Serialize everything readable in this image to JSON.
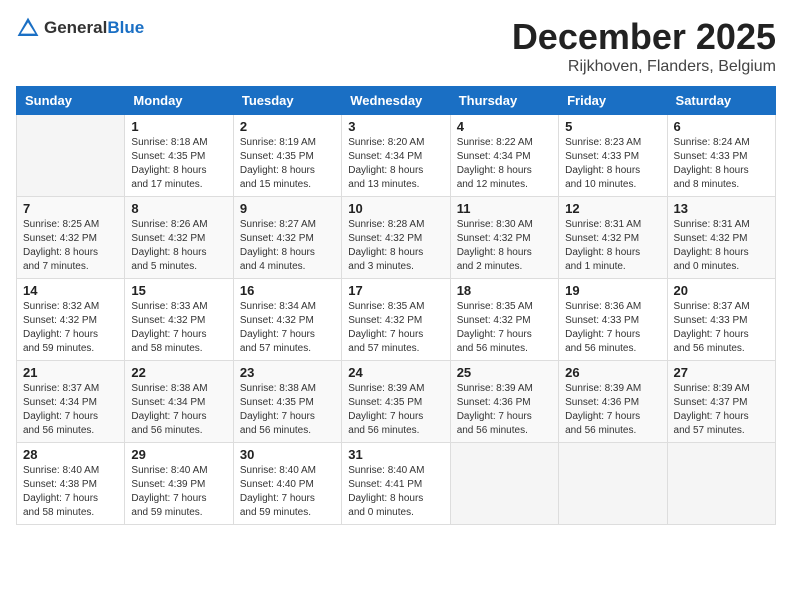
{
  "header": {
    "logo_general": "General",
    "logo_blue": "Blue",
    "month": "December 2025",
    "location": "Rijkhoven, Flanders, Belgium"
  },
  "weekdays": [
    "Sunday",
    "Monday",
    "Tuesday",
    "Wednesday",
    "Thursday",
    "Friday",
    "Saturday"
  ],
  "weeks": [
    [
      {
        "day": "",
        "info": ""
      },
      {
        "day": "1",
        "info": "Sunrise: 8:18 AM\nSunset: 4:35 PM\nDaylight: 8 hours\nand 17 minutes."
      },
      {
        "day": "2",
        "info": "Sunrise: 8:19 AM\nSunset: 4:35 PM\nDaylight: 8 hours\nand 15 minutes."
      },
      {
        "day": "3",
        "info": "Sunrise: 8:20 AM\nSunset: 4:34 PM\nDaylight: 8 hours\nand 13 minutes."
      },
      {
        "day": "4",
        "info": "Sunrise: 8:22 AM\nSunset: 4:34 PM\nDaylight: 8 hours\nand 12 minutes."
      },
      {
        "day": "5",
        "info": "Sunrise: 8:23 AM\nSunset: 4:33 PM\nDaylight: 8 hours\nand 10 minutes."
      },
      {
        "day": "6",
        "info": "Sunrise: 8:24 AM\nSunset: 4:33 PM\nDaylight: 8 hours\nand 8 minutes."
      }
    ],
    [
      {
        "day": "7",
        "info": "Sunrise: 8:25 AM\nSunset: 4:32 PM\nDaylight: 8 hours\nand 7 minutes."
      },
      {
        "day": "8",
        "info": "Sunrise: 8:26 AM\nSunset: 4:32 PM\nDaylight: 8 hours\nand 5 minutes."
      },
      {
        "day": "9",
        "info": "Sunrise: 8:27 AM\nSunset: 4:32 PM\nDaylight: 8 hours\nand 4 minutes."
      },
      {
        "day": "10",
        "info": "Sunrise: 8:28 AM\nSunset: 4:32 PM\nDaylight: 8 hours\nand 3 minutes."
      },
      {
        "day": "11",
        "info": "Sunrise: 8:30 AM\nSunset: 4:32 PM\nDaylight: 8 hours\nand 2 minutes."
      },
      {
        "day": "12",
        "info": "Sunrise: 8:31 AM\nSunset: 4:32 PM\nDaylight: 8 hours\nand 1 minute."
      },
      {
        "day": "13",
        "info": "Sunrise: 8:31 AM\nSunset: 4:32 PM\nDaylight: 8 hours\nand 0 minutes."
      }
    ],
    [
      {
        "day": "14",
        "info": "Sunrise: 8:32 AM\nSunset: 4:32 PM\nDaylight: 7 hours\nand 59 minutes."
      },
      {
        "day": "15",
        "info": "Sunrise: 8:33 AM\nSunset: 4:32 PM\nDaylight: 7 hours\nand 58 minutes."
      },
      {
        "day": "16",
        "info": "Sunrise: 8:34 AM\nSunset: 4:32 PM\nDaylight: 7 hours\nand 57 minutes."
      },
      {
        "day": "17",
        "info": "Sunrise: 8:35 AM\nSunset: 4:32 PM\nDaylight: 7 hours\nand 57 minutes."
      },
      {
        "day": "18",
        "info": "Sunrise: 8:35 AM\nSunset: 4:32 PM\nDaylight: 7 hours\nand 56 minutes."
      },
      {
        "day": "19",
        "info": "Sunrise: 8:36 AM\nSunset: 4:33 PM\nDaylight: 7 hours\nand 56 minutes."
      },
      {
        "day": "20",
        "info": "Sunrise: 8:37 AM\nSunset: 4:33 PM\nDaylight: 7 hours\nand 56 minutes."
      }
    ],
    [
      {
        "day": "21",
        "info": "Sunrise: 8:37 AM\nSunset: 4:34 PM\nDaylight: 7 hours\nand 56 minutes."
      },
      {
        "day": "22",
        "info": "Sunrise: 8:38 AM\nSunset: 4:34 PM\nDaylight: 7 hours\nand 56 minutes."
      },
      {
        "day": "23",
        "info": "Sunrise: 8:38 AM\nSunset: 4:35 PM\nDaylight: 7 hours\nand 56 minutes."
      },
      {
        "day": "24",
        "info": "Sunrise: 8:39 AM\nSunset: 4:35 PM\nDaylight: 7 hours\nand 56 minutes."
      },
      {
        "day": "25",
        "info": "Sunrise: 8:39 AM\nSunset: 4:36 PM\nDaylight: 7 hours\nand 56 minutes."
      },
      {
        "day": "26",
        "info": "Sunrise: 8:39 AM\nSunset: 4:36 PM\nDaylight: 7 hours\nand 56 minutes."
      },
      {
        "day": "27",
        "info": "Sunrise: 8:39 AM\nSunset: 4:37 PM\nDaylight: 7 hours\nand 57 minutes."
      }
    ],
    [
      {
        "day": "28",
        "info": "Sunrise: 8:40 AM\nSunset: 4:38 PM\nDaylight: 7 hours\nand 58 minutes."
      },
      {
        "day": "29",
        "info": "Sunrise: 8:40 AM\nSunset: 4:39 PM\nDaylight: 7 hours\nand 59 minutes."
      },
      {
        "day": "30",
        "info": "Sunrise: 8:40 AM\nSunset: 4:40 PM\nDaylight: 7 hours\nand 59 minutes."
      },
      {
        "day": "31",
        "info": "Sunrise: 8:40 AM\nSunset: 4:41 PM\nDaylight: 8 hours\nand 0 minutes."
      },
      {
        "day": "",
        "info": ""
      },
      {
        "day": "",
        "info": ""
      },
      {
        "day": "",
        "info": ""
      }
    ]
  ]
}
